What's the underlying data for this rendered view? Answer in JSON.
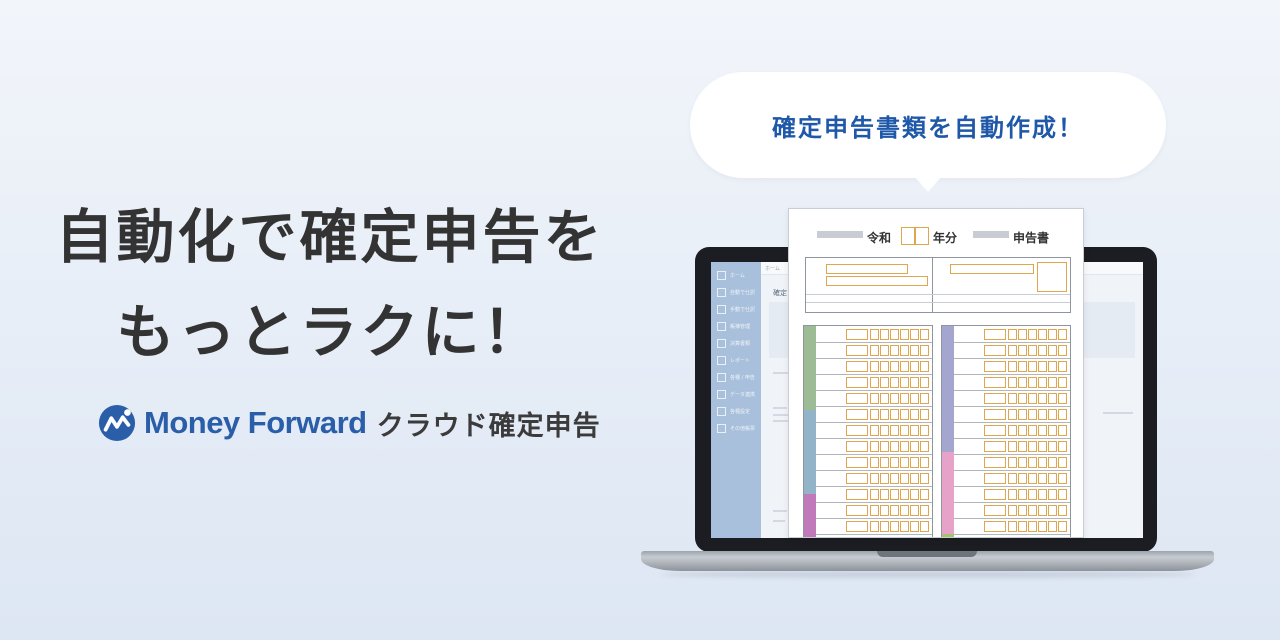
{
  "headline": {
    "line1": "自動化で確定申告を",
    "line2": "もっとラクに！"
  },
  "brand": {
    "name": "Money Forward",
    "product": "クラウド確定申告",
    "color": "#2a5ea8"
  },
  "bubble": {
    "text": "確定申告書類を自動作成！",
    "color": "#1f58a8"
  },
  "document": {
    "era": "令和",
    "year_suffix": "年分",
    "title": "申告書"
  },
  "app": {
    "breadcrumb": "ホーム",
    "page_title": "確定",
    "sidebar_items": [
      {
        "label": "ホーム",
        "icon": "home-icon"
      },
      {
        "label": "自動で仕訳",
        "icon": "auto-journal-icon"
      },
      {
        "label": "手動で仕訳",
        "icon": "manual-journal-icon"
      },
      {
        "label": "帳簿管理",
        "icon": "ledger-icon"
      },
      {
        "label": "決算書類",
        "icon": "statement-icon"
      },
      {
        "label": "レポート",
        "icon": "report-icon"
      },
      {
        "label": "各種 / 申告",
        "icon": "tax-icon"
      },
      {
        "label": "データ連携",
        "icon": "sync-icon"
      },
      {
        "label": "各種設定",
        "icon": "gear-icon"
      },
      {
        "label": "その他帳票",
        "icon": "list-icon"
      }
    ]
  },
  "strip_colors": {
    "green": "#9dbb94",
    "blue": "#93b3c8",
    "magenta": "#c07aba",
    "purple": "#a5a6cf",
    "pink": "#e7a2c9",
    "lime": "#a5c46d"
  }
}
